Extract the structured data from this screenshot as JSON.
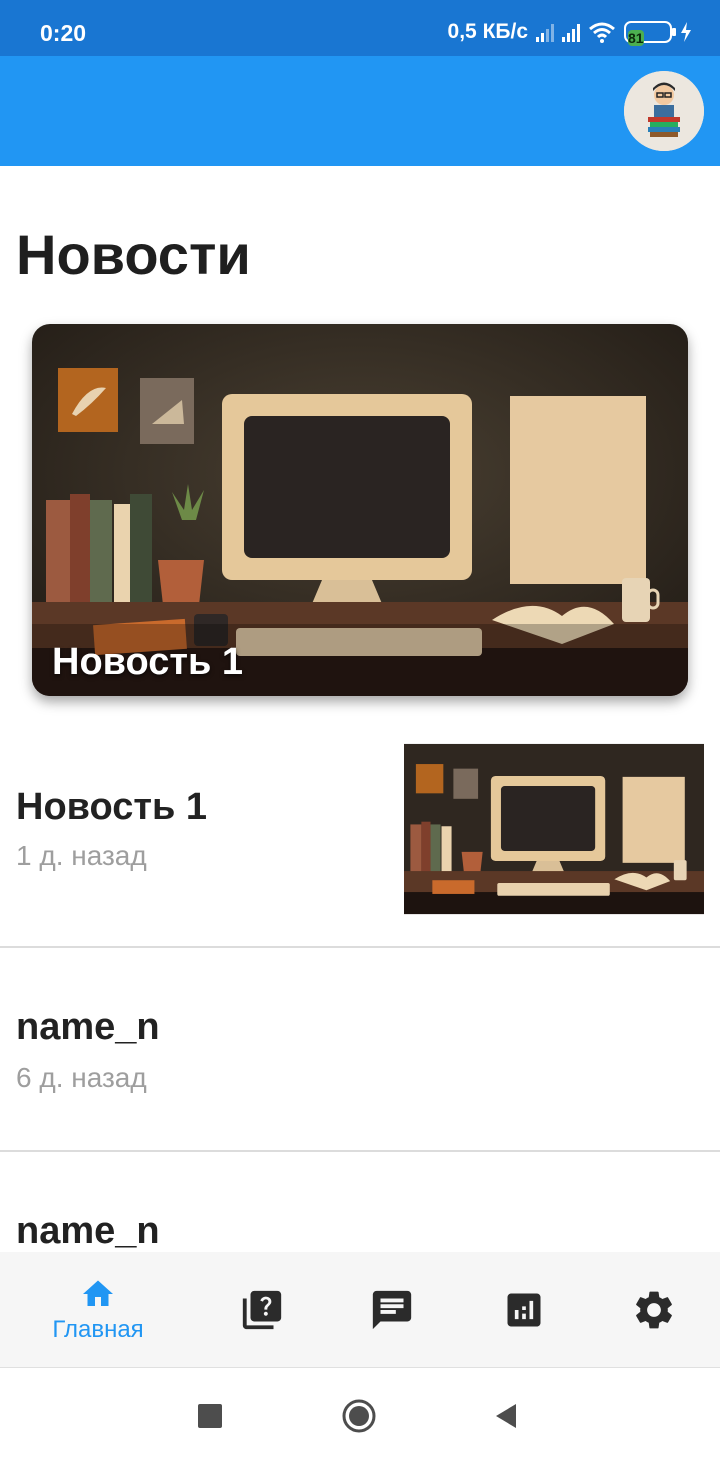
{
  "status_bar": {
    "time": "0:20",
    "network_speed": "0,5 КБ/с",
    "battery_level": "81",
    "battery_percent": 81
  },
  "app_bar": {
    "avatar_icon": "student-avatar"
  },
  "main": {
    "title": "Новости",
    "featured": {
      "title": "Новость 1",
      "image_icon": "retro-desk-illustration"
    },
    "news": [
      {
        "title": "Новость 1",
        "time": "1 д. назад",
        "image_icon": "retro-desk-illustration"
      },
      {
        "title": "name_n",
        "time": "6 д. назад"
      },
      {
        "title": "name_n"
      }
    ]
  },
  "bottom_nav": {
    "items": [
      {
        "icon": "home-icon",
        "label": "Главная",
        "active": true
      },
      {
        "icon": "quiz-icon"
      },
      {
        "icon": "chat-icon"
      },
      {
        "icon": "stats-icon"
      },
      {
        "icon": "gear-icon"
      }
    ],
    "accent_color": "#2196f3",
    "inactive_color": "#2b2b2b"
  },
  "colors": {
    "status_bar": "#1976d2",
    "app_bar": "#2196f3"
  }
}
